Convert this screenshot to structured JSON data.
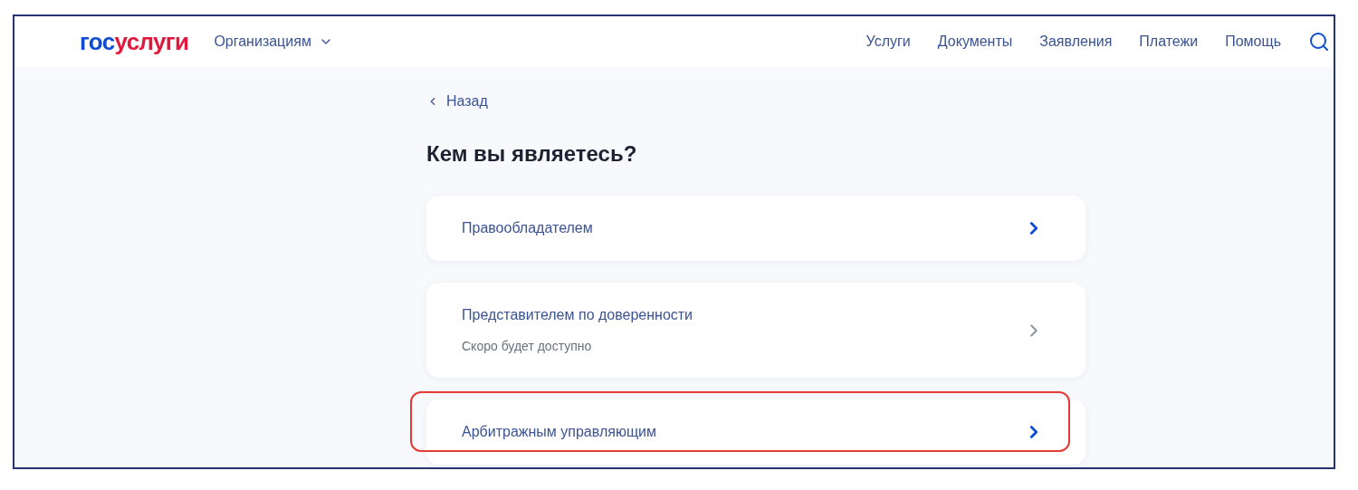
{
  "header": {
    "logo": {
      "part_1": "гос",
      "part_2": "услуги"
    },
    "section_menu": "Организациям",
    "nav": [
      "Услуги",
      "Документы",
      "Заявления",
      "Платежи",
      "Помощь"
    ]
  },
  "back_link": "Назад",
  "title": "Кем вы являетесь?",
  "options": [
    {
      "label": "Правообладателем",
      "disabled": false,
      "highlighted": false
    },
    {
      "label": "Представителем по доверенности",
      "note": "Скоро будет доступно",
      "disabled": true,
      "highlighted": false
    },
    {
      "label": "Арбитражным управляющим",
      "disabled": false,
      "highlighted": true
    }
  ]
}
